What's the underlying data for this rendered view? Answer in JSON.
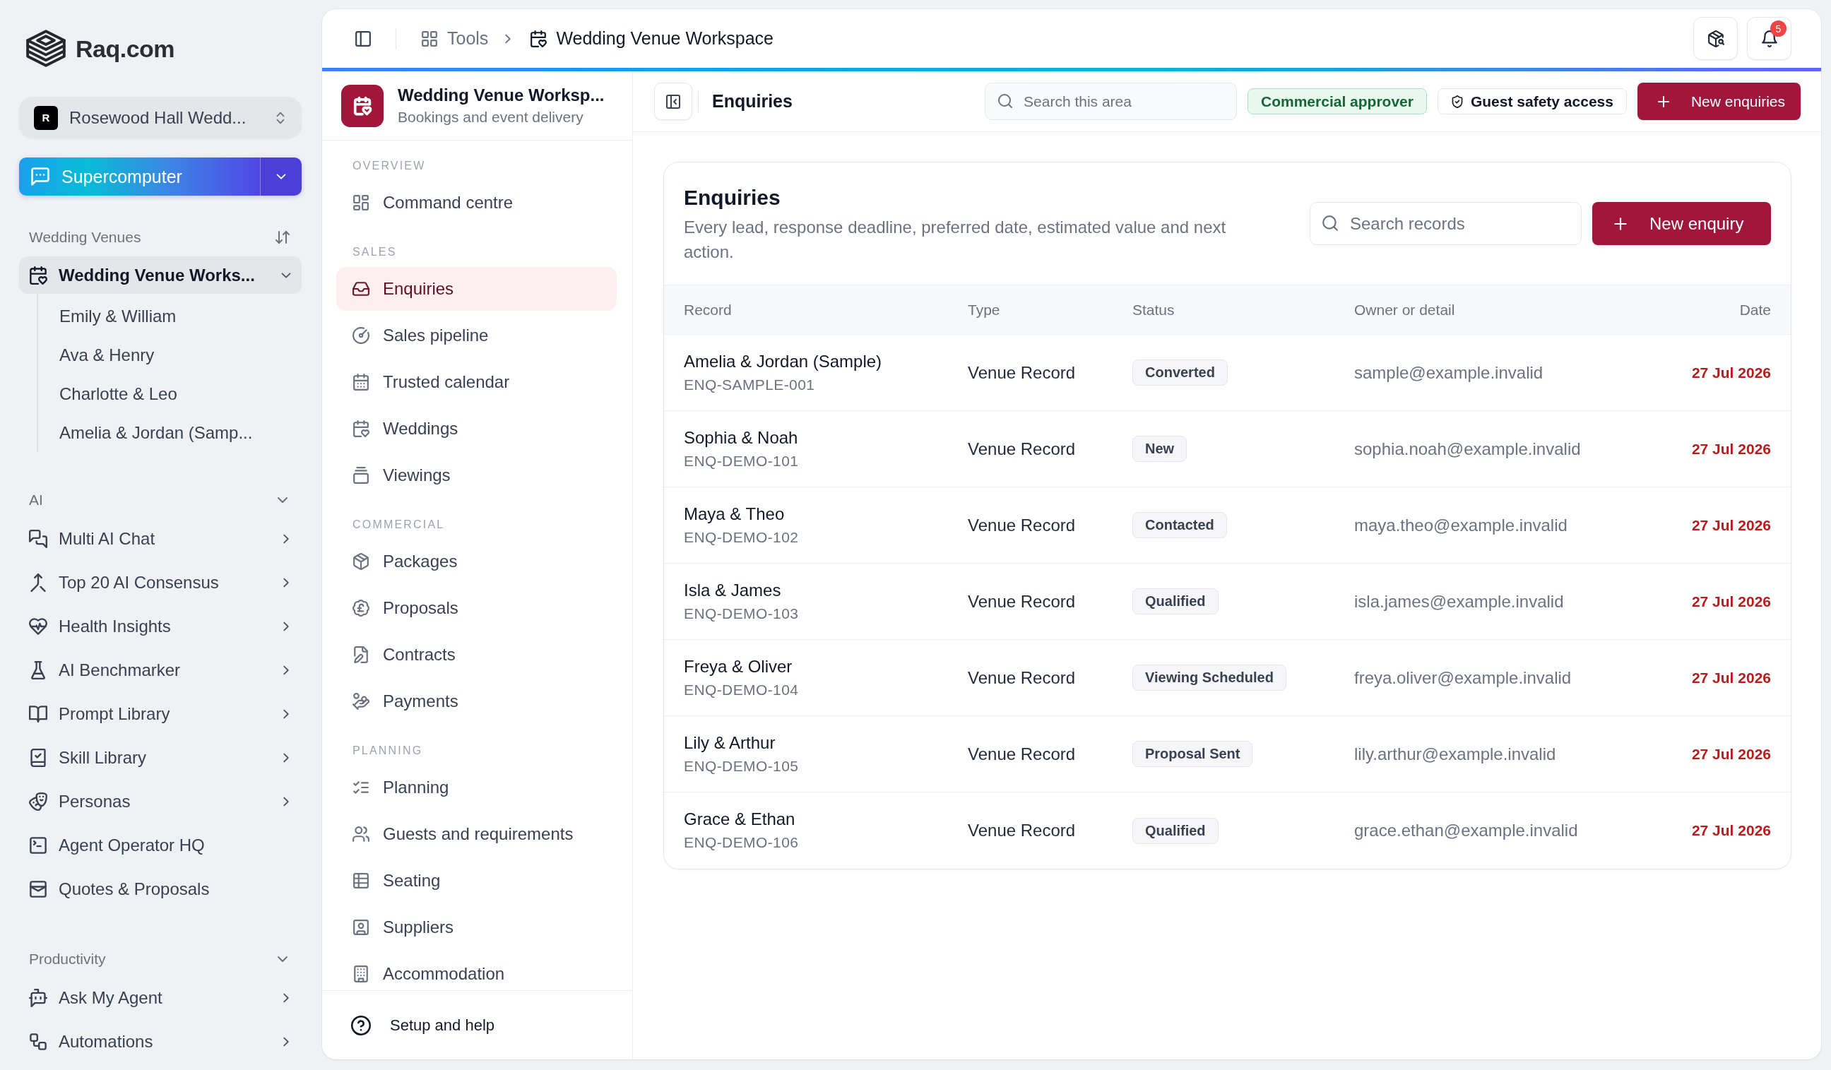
{
  "sidebar": {
    "brand": "Raq.com",
    "organization": {
      "initial": "R",
      "name": "Rosewood Hall Wedd..."
    },
    "assistant_button": {
      "label": "Supercomputer"
    },
    "sections": [
      {
        "title": "Wedding Venues",
        "kind": "sortable",
        "items": [
          {
            "label": "Wedding Venue Works...",
            "selected": true,
            "expanded": true,
            "children": [
              {
                "label": "Emily & William",
                "selected": false
              },
              {
                "label": "Ava & Henry",
                "selected": false
              },
              {
                "label": "Charlotte & Leo",
                "selected": false
              },
              {
                "label": "Amelia & Jordan (Samp...",
                "selected": false
              }
            ]
          }
        ]
      },
      {
        "title": "AI",
        "kind": "collapsible",
        "expanded": true,
        "items": [
          {
            "label": "Multi AI Chat",
            "selected": false,
            "has_submenu": true
          },
          {
            "label": "Top 20 AI Consensus",
            "selected": false,
            "has_submenu": true
          },
          {
            "label": "Health Insights",
            "selected": false,
            "has_submenu": true
          },
          {
            "label": "AI Benchmarker",
            "selected": false,
            "has_submenu": true
          },
          {
            "label": "Prompt Library",
            "selected": false,
            "has_submenu": true
          },
          {
            "label": "Skill Library",
            "selected": false,
            "has_submenu": true
          },
          {
            "label": "Personas",
            "selected": false,
            "has_submenu": true
          },
          {
            "label": "Agent Operator HQ",
            "selected": false,
            "has_submenu": false
          },
          {
            "label": "Quotes & Proposals",
            "selected": false,
            "has_submenu": false
          }
        ]
      },
      {
        "title": "Productivity",
        "kind": "collapsible",
        "expanded": true,
        "items": [
          {
            "label": "Ask My Agent",
            "selected": false,
            "has_submenu": true
          },
          {
            "label": "Automations",
            "selected": false,
            "has_submenu": true
          }
        ]
      }
    ]
  },
  "topbar": {
    "breadcrumb": [
      {
        "label": "Tools",
        "current": false
      },
      {
        "label": "Wedding Venue Workspace",
        "current": true
      }
    ],
    "notifications": {
      "count": "5"
    }
  },
  "workspace_nav": {
    "title": "Wedding Venue Worksp...",
    "subtitle": "Bookings and event delivery",
    "groups": [
      {
        "title": "OVERVIEW",
        "items": [
          {
            "label": "Command centre",
            "selected": false
          }
        ]
      },
      {
        "title": "SALES",
        "items": [
          {
            "label": "Enquiries",
            "selected": true
          },
          {
            "label": "Sales pipeline",
            "selected": false
          },
          {
            "label": "Trusted calendar",
            "selected": false
          },
          {
            "label": "Weddings",
            "selected": false
          },
          {
            "label": "Viewings",
            "selected": false
          }
        ]
      },
      {
        "title": "COMMERCIAL",
        "items": [
          {
            "label": "Packages",
            "selected": false
          },
          {
            "label": "Proposals",
            "selected": false
          },
          {
            "label": "Contracts",
            "selected": false
          },
          {
            "label": "Payments",
            "selected": false
          }
        ]
      },
      {
        "title": "PLANNING",
        "items": [
          {
            "label": "Planning",
            "selected": false
          },
          {
            "label": "Guests and requirements",
            "selected": false
          },
          {
            "label": "Seating",
            "selected": false
          },
          {
            "label": "Suppliers",
            "selected": false
          },
          {
            "label": "Accommodation",
            "selected": false
          }
        ]
      }
    ],
    "footer_link": "Setup and help"
  },
  "toolbar": {
    "title": "Enquiries",
    "search": {
      "placeholder": "Search this area"
    },
    "badges": [
      {
        "label": "Commercial approver",
        "kind": "role"
      },
      {
        "label": "Guest safety access",
        "kind": "access"
      }
    ],
    "primary_button": "New enquiries"
  },
  "records_card": {
    "title": "Enquiries",
    "description": "Every lead, response deadline, preferred date, estimated value and next action.",
    "search": {
      "placeholder": "Search records"
    },
    "primary_button": "New enquiry",
    "table": {
      "columns": [
        "Record",
        "Type",
        "Status",
        "Owner or detail",
        "Date"
      ],
      "rows": [
        {
          "record": "Amelia & Jordan (Sample)",
          "reference": "ENQ-SAMPLE-001",
          "type": "Venue Record",
          "status": "Converted",
          "owner": "sample@example.invalid",
          "date": "27 Jul 2026"
        },
        {
          "record": "Sophia & Noah",
          "reference": "ENQ-DEMO-101",
          "type": "Venue Record",
          "status": "New",
          "owner": "sophia.noah@example.invalid",
          "date": "27 Jul 2026"
        },
        {
          "record": "Maya & Theo",
          "reference": "ENQ-DEMO-102",
          "type": "Venue Record",
          "status": "Contacted",
          "owner": "maya.theo@example.invalid",
          "date": "27 Jul 2026"
        },
        {
          "record": "Isla & James",
          "reference": "ENQ-DEMO-103",
          "type": "Venue Record",
          "status": "Qualified",
          "owner": "isla.james@example.invalid",
          "date": "27 Jul 2026"
        },
        {
          "record": "Freya & Oliver",
          "reference": "ENQ-DEMO-104",
          "type": "Venue Record",
          "status": "Viewing Scheduled",
          "owner": "freya.oliver@example.invalid",
          "date": "27 Jul 2026"
        },
        {
          "record": "Lily & Arthur",
          "reference": "ENQ-DEMO-105",
          "type": "Venue Record",
          "status": "Proposal Sent",
          "owner": "lily.arthur@example.invalid",
          "date": "27 Jul 2026"
        },
        {
          "record": "Grace & Ethan",
          "reference": "ENQ-DEMO-106",
          "type": "Venue Record",
          "status": "Qualified",
          "owner": "grace.ethan@example.invalid",
          "date": "27 Jul 2026"
        }
      ]
    }
  }
}
